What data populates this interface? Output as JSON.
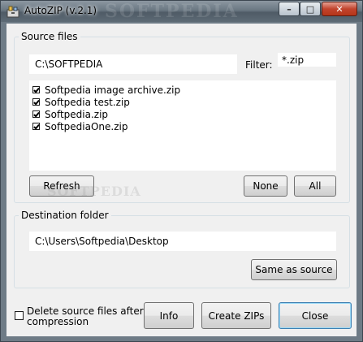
{
  "window": {
    "title": "AutoZIP (v.2.1)",
    "watermark": "SOFTPEDIA",
    "minimize_symbol": "–",
    "maximize_symbol": "□",
    "close_symbol": "✕"
  },
  "source": {
    "group_label": "Source files",
    "path": "C:\\SOFTPEDIA",
    "filter_label": "Filter:",
    "filter_value": "*.zip",
    "files": [
      {
        "name": "Softpedia image archive.zip",
        "checked": true
      },
      {
        "name": "Softpedia test.zip",
        "checked": true
      },
      {
        "name": "Softpedia.zip",
        "checked": true
      },
      {
        "name": "SoftpediaOne.zip",
        "checked": true
      }
    ],
    "refresh_label": "Refresh",
    "none_label": "None",
    "all_label": "All",
    "watermark": "SOFTPEDIA"
  },
  "destination": {
    "group_label": "Destination folder",
    "path": "C:\\Users\\Softpedia\\Desktop",
    "same_as_source_label": "Same as source"
  },
  "bottom": {
    "delete_checkbox_label_line1": "Delete source files after",
    "delete_checkbox_label_line2": "compression",
    "delete_checked": false,
    "info_label": "Info",
    "create_label": "Create ZIPs",
    "close_label": "Close"
  }
}
